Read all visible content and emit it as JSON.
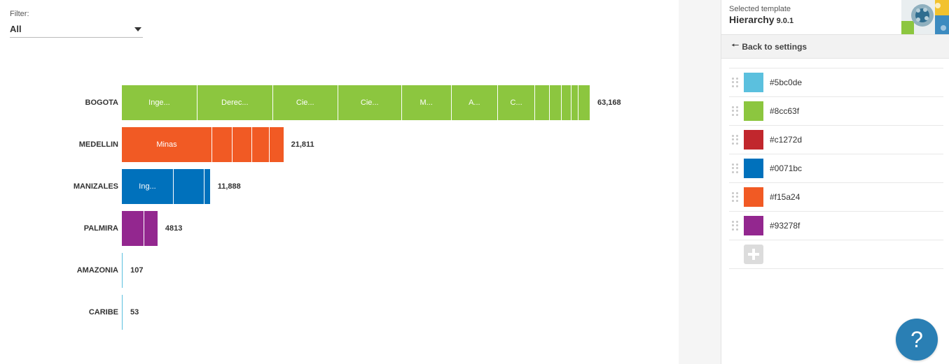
{
  "filter": {
    "label": "Filter:",
    "value": "All"
  },
  "chart_data": {
    "type": "bar",
    "orientation": "horizontal",
    "stacked": true,
    "max": 63168,
    "rows": [
      {
        "name": "BOGOTA",
        "total": 63168,
        "total_label": "63,168",
        "color": "#8cc63f",
        "segments": [
          {
            "value": 10200,
            "label": "Inge..."
          },
          {
            "value": 10200,
            "label": "Derec..."
          },
          {
            "value": 8800,
            "label": "Cie..."
          },
          {
            "value": 8600,
            "label": "Cie..."
          },
          {
            "value": 6700,
            "label": "M..."
          },
          {
            "value": 6300,
            "label": "A..."
          },
          {
            "value": 5000,
            "label": "C..."
          },
          {
            "value": 2000,
            "label": ""
          },
          {
            "value": 1600,
            "label": ""
          },
          {
            "value": 1300,
            "label": ""
          },
          {
            "value": 1000,
            "label": ""
          },
          {
            "value": 1468,
            "label": ""
          }
        ]
      },
      {
        "name": "MEDELLIN",
        "total": 21811,
        "total_label": "21,811",
        "color": "#f15a24",
        "segments": [
          {
            "value": 12200,
            "label": "Minas"
          },
          {
            "value": 2700,
            "label": ""
          },
          {
            "value": 2700,
            "label": ""
          },
          {
            "value": 2400,
            "label": ""
          },
          {
            "value": 1811,
            "label": ""
          }
        ]
      },
      {
        "name": "MANIZALES",
        "total": 11888,
        "total_label": "11,888",
        "color": "#0071bc",
        "segments": [
          {
            "value": 7000,
            "label": "Ing..."
          },
          {
            "value": 4200,
            "label": ""
          },
          {
            "value": 688,
            "label": ""
          }
        ]
      },
      {
        "name": "PALMIRA",
        "total": 4813,
        "total_label": "4813",
        "color": "#93278f",
        "segments": [
          {
            "value": 3050,
            "label": ""
          },
          {
            "value": 1763,
            "label": ""
          }
        ]
      },
      {
        "name": "AMAZONIA",
        "total": 107,
        "total_label": "107",
        "color": "#5bc0de",
        "segments": [
          {
            "value": 107,
            "label": ""
          }
        ]
      },
      {
        "name": "CARIBE",
        "total": 53,
        "total_label": "53",
        "color": "#5bc0de",
        "segments": [
          {
            "value": 53,
            "label": ""
          }
        ]
      }
    ]
  },
  "panel": {
    "caption": "Selected template",
    "template_name": "Hierarchy",
    "template_version": "9.0.1",
    "back_label": "Back to settings",
    "colors": [
      "#5bc0de",
      "#8cc63f",
      "#c1272d",
      "#0071bc",
      "#f15a24",
      "#93278f"
    ]
  },
  "help": {
    "label": "?"
  }
}
